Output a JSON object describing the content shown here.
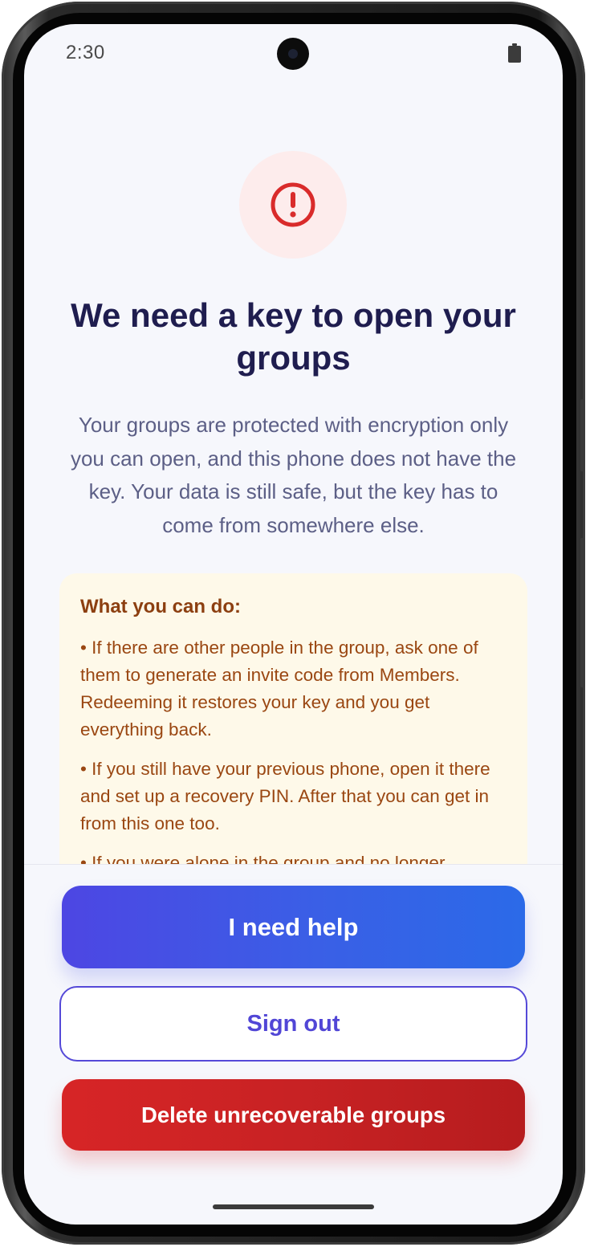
{
  "status_bar": {
    "time": "2:30"
  },
  "icons": {
    "alert": "alert-exclamation-icon",
    "battery": "battery-icon",
    "camera": "front-camera"
  },
  "colors": {
    "alert_red": "#d92b2b",
    "title": "#1f1d4f",
    "body_text": "#5c5f86",
    "tips_background": "#fef9e9",
    "tips_text": "#9a4712",
    "primary_gradient_start": "#4d46e3",
    "primary_gradient_end": "#2b6ae8",
    "outline_accent": "#5549d8",
    "danger": "#c82224"
  },
  "main": {
    "title": "We need a key to open your groups",
    "description": "Your groups are protected with encryption only you can open, and this phone does not have the key. Your data is still safe, but the key has to come from somewhere else.",
    "tips": {
      "heading": "What you can do:",
      "items": [
        "• If there are other people in the group, ask one of them to generate an invite code from Members. Redeeming it restores your key and you get everything back.",
        "• If you still have your previous phone, open it there and set up a recovery PIN. After that you can get in from this one too.",
        "• If you were alone in the group and no longer"
      ]
    }
  },
  "actions": {
    "help_label": "I need help",
    "sign_out_label": "Sign out",
    "delete_label": "Delete unrecoverable groups"
  }
}
